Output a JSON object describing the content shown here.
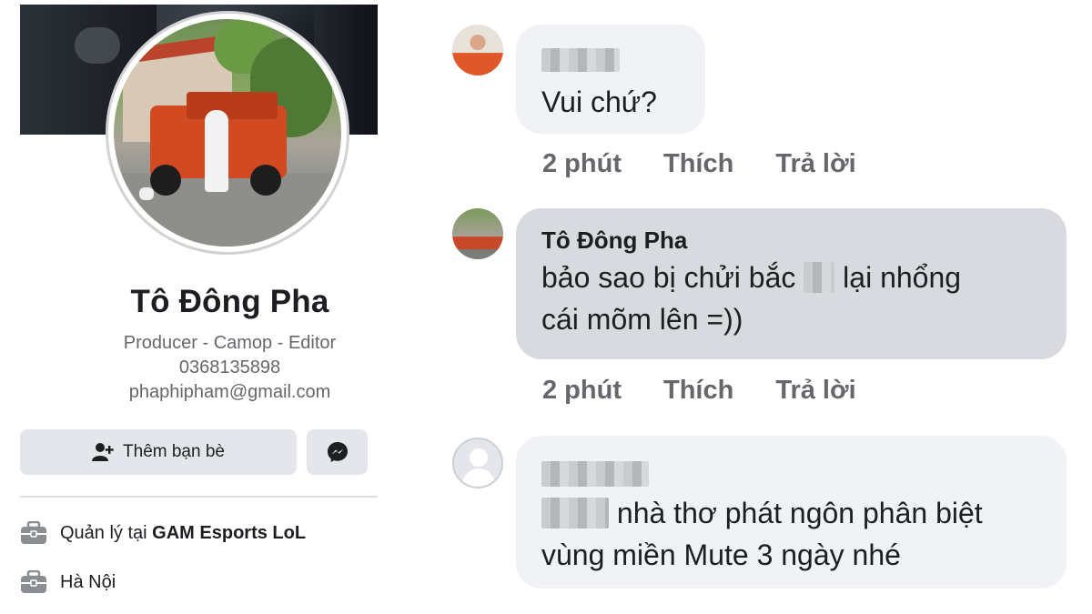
{
  "profile": {
    "name": "Tô Đông Pha",
    "bio_line1": "Producer - Camop - Editor",
    "bio_line2": "0368135898",
    "bio_line3": "phaphipham@gmail.com",
    "add_friend_label": "Thêm bạn bè",
    "info": [
      {
        "prefix": "Quản lý tại ",
        "bold": "GAM Esports LoL",
        "icon": "briefcase-icon"
      },
      {
        "prefix": "Hà Nội",
        "bold": "",
        "icon": "briefcase-icon"
      }
    ]
  },
  "comments": [
    {
      "author": "",
      "text": "Vui chứ?",
      "time": "2 phút",
      "like": "Thích",
      "reply": "Trả lời"
    },
    {
      "author": "Tô Đông Pha",
      "text_line1_a": "bảo sao bị chửi bắc",
      "text_line1_b": "lại nhổng",
      "text_line2": "cái mõm lên =))",
      "time": "2 phút",
      "like": "Thích",
      "reply": "Trả lời"
    },
    {
      "author": "",
      "text_line1": "nhà thơ phát ngôn phân biệt",
      "text_line2": "vùng miền Mute 3 ngày nhé",
      "time": "",
      "like": "",
      "reply": ""
    }
  ],
  "colors": {
    "secondary_text": "#65676b",
    "button_bg": "#e4e6eb",
    "bubble_bg": "#f0f2f5",
    "highlight_bubble_bg": "#d8dadf"
  }
}
